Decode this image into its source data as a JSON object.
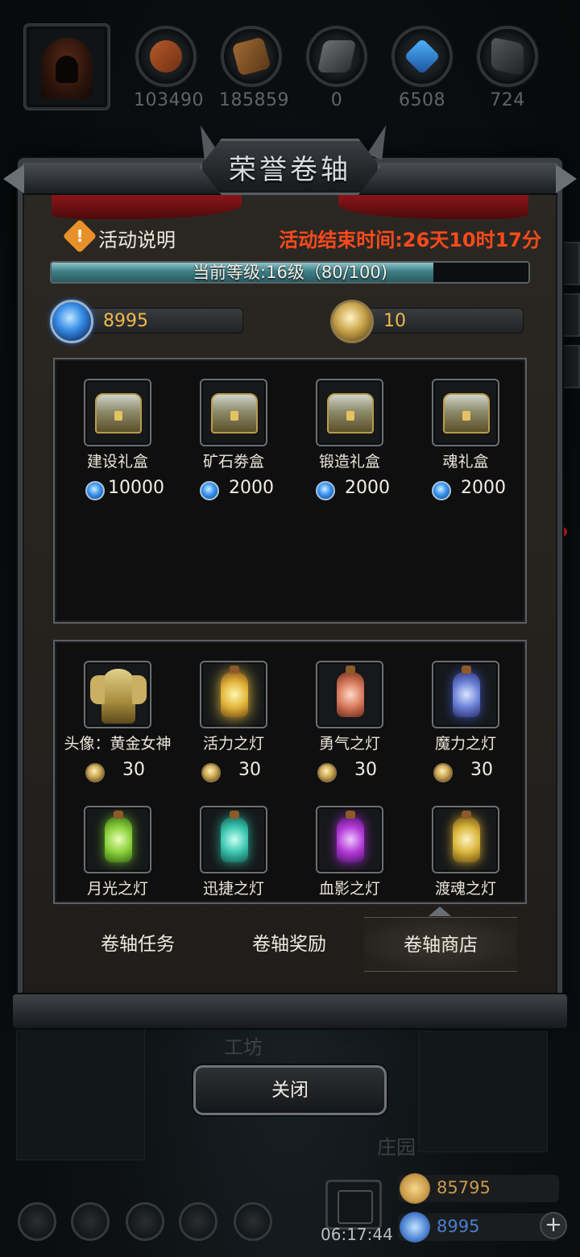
{
  "top_bar": {
    "resources": [
      {
        "icon": "wood-log-icon",
        "value": "103490"
      },
      {
        "icon": "plank-icon",
        "value": "185859"
      },
      {
        "icon": "iron-ingot-icon",
        "value": "0"
      },
      {
        "icon": "crystal-icon",
        "value": "6508"
      },
      {
        "icon": "stone-slab-icon",
        "value": "724"
      }
    ]
  },
  "panel": {
    "title": "荣誉卷轴",
    "info_label": "活动说明",
    "end_time": "活动结束时间:26天10时17分",
    "level": {
      "text": "当前等级:16级（80/100)",
      "progress": 0.8
    },
    "currency": {
      "gems": "8995",
      "coins": "10"
    }
  },
  "gift_boxes": [
    {
      "name": "建设礼盒",
      "price": "10000",
      "currency_icon": "gem-icon"
    },
    {
      "name": "矿石劵盒",
      "price": "2000",
      "currency_icon": "gem-icon"
    },
    {
      "name": "锻造礼盒",
      "price": "2000",
      "currency_icon": "gem-icon"
    },
    {
      "name": "魂礼盒",
      "price": "2000",
      "currency_icon": "gem-icon"
    }
  ],
  "shop_items": [
    {
      "name": "头像：黄金女神",
      "price": "30",
      "icon": "golden-goddess-statue-icon"
    },
    {
      "name": "活力之灯",
      "price": "30",
      "icon": "yellow-lantern-icon"
    },
    {
      "name": "勇气之灯",
      "price": "30",
      "icon": "red-lantern-icon"
    },
    {
      "name": "魔力之灯",
      "price": "30",
      "icon": "blue-lantern-icon"
    },
    {
      "name": "月光之灯",
      "icon": "green-lantern-icon"
    },
    {
      "name": "迅捷之灯",
      "icon": "cyan-lantern-icon"
    },
    {
      "name": "血影之灯",
      "icon": "purple-lantern-icon"
    },
    {
      "name": "渡魂之灯",
      "icon": "gold-lantern-icon"
    }
  ],
  "tabs": [
    {
      "label": "卷轴任务"
    },
    {
      "label": "卷轴奖励"
    },
    {
      "label": "卷轴商店",
      "active": true
    }
  ],
  "close_label": "关闭",
  "background": {
    "workshop_label": "工坊",
    "manor_label": "庄园"
  },
  "bottom_dock": {
    "clock": "06:17:44",
    "gold": "85795",
    "gems": "8995",
    "colors": {
      "gold": "#c99a4a",
      "gems": "#4a7fd0"
    }
  },
  "colors": {
    "end_time": "#ff4a1c",
    "currency_value": "#f0b94a",
    "progress_fill": "#3f7f88"
  }
}
